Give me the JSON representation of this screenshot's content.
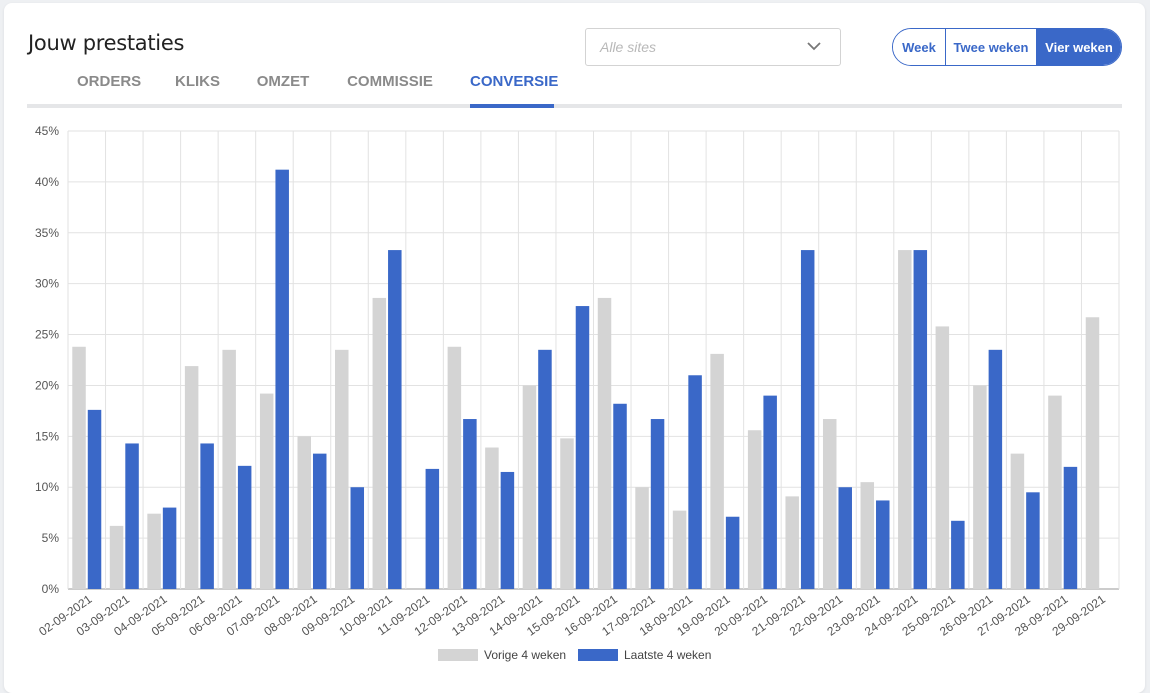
{
  "header": {
    "title": "Jouw prestaties"
  },
  "tabs": [
    {
      "label": "ORDERS",
      "active": false
    },
    {
      "label": "KLIKS",
      "active": false
    },
    {
      "label": "OMZET",
      "active": false
    },
    {
      "label": "COMMISSIE",
      "active": false
    },
    {
      "label": "CONVERSIE",
      "active": true
    }
  ],
  "site_select": {
    "placeholder": "Alle sites"
  },
  "period_toggle": [
    {
      "label": "Week",
      "active": false
    },
    {
      "label": "Twee weken",
      "active": false
    },
    {
      "label": "Vier weken",
      "active": true
    }
  ],
  "colors": {
    "accent": "#3a68c8",
    "previous": "#d4d4d4",
    "current": "#3a68c8"
  },
  "chart_data": {
    "type": "bar",
    "categories": [
      "02-09-2021",
      "03-09-2021",
      "04-09-2021",
      "05-09-2021",
      "06-09-2021",
      "07-09-2021",
      "08-09-2021",
      "09-09-2021",
      "10-09-2021",
      "11-09-2021",
      "12-09-2021",
      "13-09-2021",
      "14-09-2021",
      "15-09-2021",
      "16-09-2021",
      "17-09-2021",
      "18-09-2021",
      "19-09-2021",
      "20-09-2021",
      "21-09-2021",
      "22-09-2021",
      "23-09-2021",
      "24-09-2021",
      "25-09-2021",
      "26-09-2021",
      "27-09-2021",
      "28-09-2021",
      "29-09-2021"
    ],
    "series": [
      {
        "name": "Vorige 4 weken",
        "color": "#d4d4d4",
        "values": [
          23.8,
          6.2,
          7.4,
          21.9,
          23.5,
          19.2,
          15.0,
          23.5,
          28.6,
          0,
          23.8,
          13.9,
          20.0,
          14.8,
          28.6,
          10.0,
          7.7,
          23.1,
          15.6,
          9.1,
          16.7,
          10.5,
          33.3,
          25.8,
          20.0,
          13.3,
          19.0,
          26.7
        ]
      },
      {
        "name": "Laatste 4 weken",
        "color": "#3a68c8",
        "values": [
          17.6,
          14.3,
          8.0,
          14.3,
          12.1,
          41.2,
          13.3,
          10.0,
          33.3,
          11.8,
          16.7,
          11.5,
          23.5,
          27.8,
          18.2,
          16.7,
          21.0,
          7.1,
          19.0,
          33.3,
          10.0,
          8.7,
          33.3,
          6.7,
          23.5,
          9.5,
          12.0,
          0
        ]
      }
    ],
    "yticks": [
      "0%",
      "5%",
      "10%",
      "15%",
      "20%",
      "25%",
      "30%",
      "35%",
      "40%",
      "45%"
    ],
    "ylim": [
      0,
      45
    ],
    "ylabel": "",
    "xlabel": "",
    "grid": true,
    "legend": "bottom-center"
  }
}
